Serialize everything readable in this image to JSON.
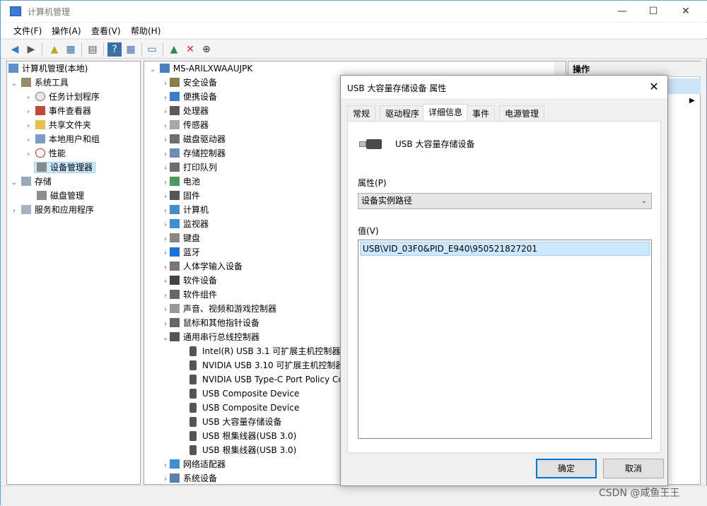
{
  "window": {
    "title": "计算机管理",
    "controls": {
      "minimize": "—",
      "maximize": "☐",
      "close": "✕"
    }
  },
  "menu": [
    "文件(F)",
    "操作(A)",
    "查看(V)",
    "帮助(H)"
  ],
  "left_tree": {
    "root": "计算机管理(本地)",
    "system_tools": "系统工具",
    "task_scheduler": "任务计划程序",
    "event_viewer": "事件查看器",
    "shared_folders": "共享文件夹",
    "local_users": "本地用户和组",
    "performance": "性能",
    "device_manager": "设备管理器",
    "storage": "存储",
    "disk_management": "磁盘管理",
    "services_apps": "服务和应用程序"
  },
  "device_tree": {
    "computer": "MS-ARILXWAAUJPK",
    "categories": [
      "安全设备",
      "便携设备",
      "处理器",
      "传感器",
      "磁盘驱动器",
      "存储控制器",
      "打印队列",
      "电池",
      "固件",
      "计算机",
      "监视器",
      "键盘",
      "蓝牙",
      "人体学输入设备",
      "软件设备",
      "软件组件",
      "声音、视频和游戏控制器",
      "鼠标和其他指针设备",
      "通用串行总线控制器"
    ],
    "usb_children": [
      "Intel(R) USB 3.1 可扩展主机控制器 -",
      "NVIDIA USB 3.10 可扩展主机控制器",
      "NVIDIA USB Type-C Port Policy Co",
      "USB Composite Device",
      "USB Composite Device",
      "USB 大容量存储设备",
      "USB 根集线器(USB 3.0)",
      "USB 根集线器(USB 3.0)"
    ],
    "after": [
      "网络适配器",
      "系统设备"
    ]
  },
  "actions_panel": {
    "header": "操作"
  },
  "dialog": {
    "title": "USB 大容量存储设备 属性",
    "tabs": [
      "常规",
      "驱动程序",
      "详细信息",
      "事件",
      "电源管理"
    ],
    "active_tab": "详细信息",
    "device_name": "USB 大容量存储设备",
    "property_label": "属性(P)",
    "property_value": "设备实例路径",
    "value_label": "值(V)",
    "value_item": "USB\\VID_03F0&PID_E940\\950521827201",
    "ok": "确定",
    "cancel": "取消"
  },
  "watermark": "CSDN @咸鱼王王",
  "colors": {
    "accent": "#0078d7",
    "selection": "#cce8ff"
  }
}
